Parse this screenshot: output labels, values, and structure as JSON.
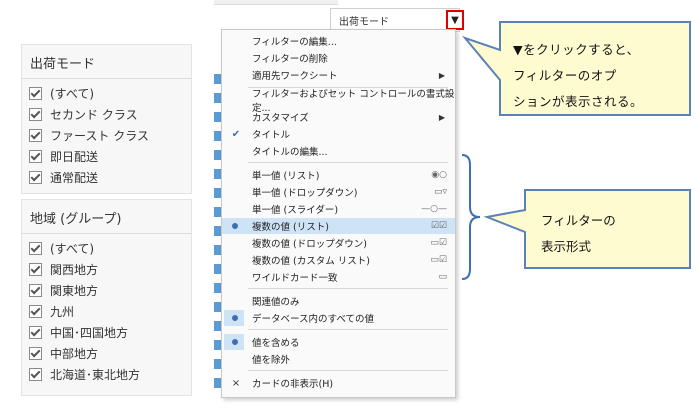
{
  "shipping_card": {
    "title": "出荷モード",
    "items": [
      "(すべて)",
      "セカンド クラス",
      "ファースト クラス",
      "即日配送",
      "通常配送"
    ]
  },
  "region_card": {
    "title": "地域 (グループ)",
    "items": [
      "(すべて)",
      "関西地方",
      "関東地方",
      "九州",
      "中国･四国地方",
      "中部地方",
      "北海道･東北地方"
    ]
  },
  "filter_header": {
    "title": "出荷モード",
    "dropdown_symbol": "▼"
  },
  "menu": {
    "edit_filter": "フィルターの編集...",
    "delete_filter": "フィルターの削除",
    "apply_to": "適用先ワークシート",
    "format_filters": "フィルターおよびセット コントロールの書式設定...",
    "customize": "カスタマイズ",
    "title": "タイトル",
    "edit_title": "タイトルの編集...",
    "single_list": "単一値 (リスト)",
    "single_dropdown": "単一値 (ドロップダウン)",
    "single_slider": "単一値 (スライダー)",
    "multi_list": "複数の値 (リスト)",
    "multi_dropdown": "複数の値 (ドロップダウン)",
    "multi_custom": "複数の値 (カスタム リスト)",
    "wildcard": "ワイルドカード一致",
    "relevant_only": "関連値のみ",
    "all_in_db": "データベース内のすべての値",
    "include": "値を含める",
    "exclude": "値を除外",
    "hide_card": "カードの非表示(H)"
  },
  "callouts": {
    "dropdown_note": [
      "▼をクリックすると、",
      "フィルターのオプ",
      "ションが表示される。"
    ],
    "display_format_note": [
      "フィルターの",
      "表示形式"
    ]
  },
  "colors": {
    "callout_fill": "#fffbd1",
    "callout_border": "#5a82b8",
    "highlight_border": "#e00000",
    "menu_selected": "#cfe3f7"
  }
}
